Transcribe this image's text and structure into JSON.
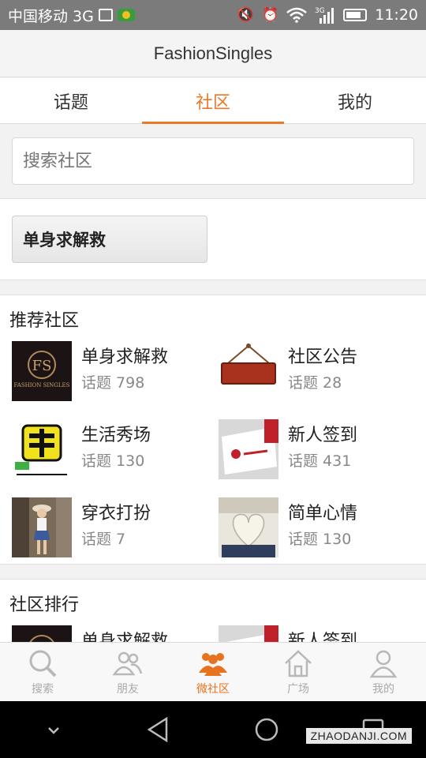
{
  "status_bar": {
    "carrier": "中国移动 3G",
    "network": "3G",
    "time": "11:20"
  },
  "app": {
    "title": "FashionSingles"
  },
  "tabs": [
    {
      "label": "话题",
      "active": false
    },
    {
      "label": "社区",
      "active": true
    },
    {
      "label": "我的",
      "active": false
    }
  ],
  "search": {
    "placeholder": "搜索社区",
    "value": ""
  },
  "joined": {
    "button_label": "单身求解救"
  },
  "recommended": {
    "title": "推荐社区",
    "count_label": "话题",
    "items": [
      {
        "name": "单身求解救",
        "count": "798",
        "icon": "fashion-singles-logo"
      },
      {
        "name": "社区公告",
        "count": "28",
        "icon": "notice-sign"
      },
      {
        "name": "生活秀场",
        "count": "130",
        "icon": "show-logo"
      },
      {
        "name": "新人签到",
        "count": "431",
        "icon": "sign-in-card"
      },
      {
        "name": "穿衣打扮",
        "count": "7",
        "icon": "girl-photo"
      },
      {
        "name": "简单心情",
        "count": "130",
        "icon": "book-heart-photo"
      }
    ]
  },
  "ranking": {
    "title": "社区排行",
    "items": [
      {
        "name": "单身求解救",
        "icon": "fashion-singles-logo"
      },
      {
        "name": "新人签到",
        "icon": "sign-in-card"
      }
    ]
  },
  "bottom_tabs": [
    {
      "label": "搜索",
      "icon": "search-icon",
      "active": false
    },
    {
      "label": "朋友",
      "icon": "friends-icon",
      "active": false
    },
    {
      "label": "微社区",
      "icon": "community-icon",
      "active": true
    },
    {
      "label": "广场",
      "icon": "home-icon",
      "active": false
    },
    {
      "label": "我的",
      "icon": "profile-icon",
      "active": false
    }
  ],
  "colors": {
    "accent": "#e87a2a",
    "text": "#222222",
    "muted": "#888888"
  },
  "watermark": "ZHAODANJI.COM"
}
